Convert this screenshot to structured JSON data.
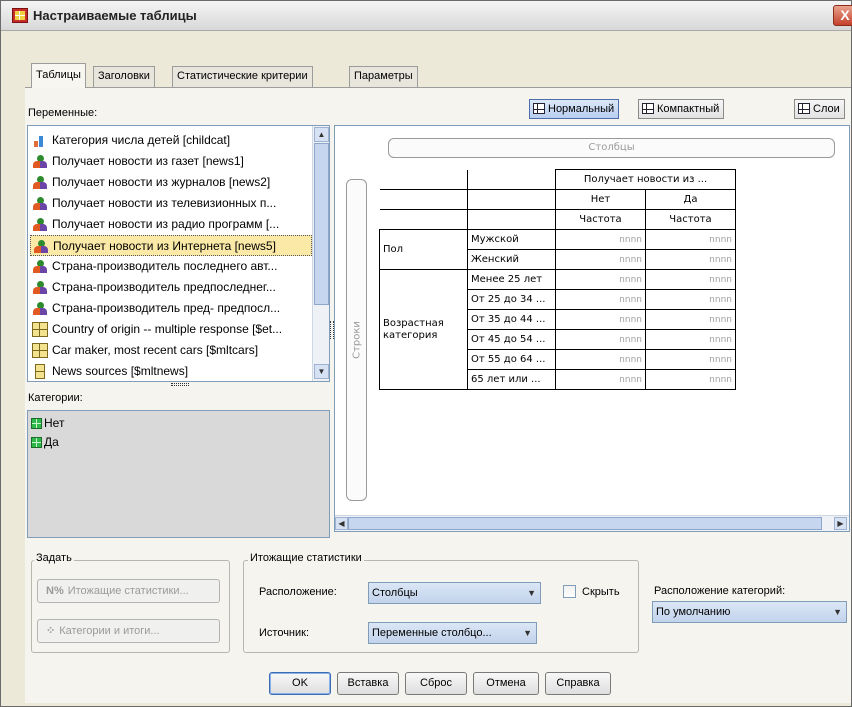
{
  "window": {
    "title": "Настраиваемые таблицы",
    "close_glyph": "X"
  },
  "tabs": [
    "Таблицы",
    "Заголовки",
    "Статистические критерии",
    "Параметры"
  ],
  "variables_label": "Переменные:",
  "view_buttons": {
    "normal": "Нормальный",
    "compact": "Компактный",
    "layers": "Слои"
  },
  "variables": [
    {
      "icon": "ordinal-bar-icon",
      "label": "Категория числа детей [childcat]"
    },
    {
      "icon": "nominal-person-icon",
      "label": "Получает новости из газет [news1]"
    },
    {
      "icon": "nominal-person-icon",
      "label": "Получает новости из журналов [news2]"
    },
    {
      "icon": "nominal-person-icon",
      "label": "Получает новости из телевизионных п..."
    },
    {
      "icon": "nominal-person-icon",
      "label": "Получает новости из радио программ [..."
    },
    {
      "icon": "nominal-person-icon",
      "label": "Получает новости из Интернета [news5]"
    },
    {
      "icon": "nominal-person-icon",
      "label": "Страна-производитель последнего авт..."
    },
    {
      "icon": "nominal-person-icon",
      "label": "Страна-производитель предпоследнег..."
    },
    {
      "icon": "nominal-person-icon",
      "label": "Страна-производитель пред- предпосл..."
    },
    {
      "icon": "multiple-response-icon",
      "label": "Country of origin -- multiple response [$et..."
    },
    {
      "icon": "multiple-response-icon",
      "label": "Car maker, most recent cars [$mltcars]"
    },
    {
      "icon": "multiple-response-single-icon",
      "label": "News sources [$mltnews]"
    }
  ],
  "selected_variable_index": 5,
  "categories_label": "Категории:",
  "categories": [
    "Нет",
    "Да"
  ],
  "canvas": {
    "columns_zone": "Столбцы",
    "rows_zone": "Строки",
    "table": {
      "col_var": "Получает новости из ...",
      "col_cats": [
        "Нет",
        "Да"
      ],
      "stat": "Частота",
      "row_groups": [
        {
          "var": "Пол",
          "cats": [
            "Мужской",
            "Женский"
          ]
        },
        {
          "var": "Возрастная категория",
          "cats": [
            "Менее 25 лет",
            "От 25 до 34 ...",
            "От 35 до 44 ...",
            "От 45 до 54 ...",
            "От 55 до 64 ...",
            "65 лет или ..."
          ]
        }
      ],
      "cell_placeholder": "nnnn"
    }
  },
  "define_group": {
    "title": "Задать",
    "summary_stats_btn": "Итожащие статистики...",
    "categories_btn": "Категории и итоги..."
  },
  "summary_group": {
    "title": "Итожащие статистики",
    "position_label": "Расположение:",
    "position_value": "Столбцы",
    "hide_label": "Скрыть",
    "source_label": "Источник:",
    "source_value": "Переменные столбцо..."
  },
  "category_position": {
    "label": "Расположение категорий:",
    "value": "По умолчанию"
  },
  "dialog_buttons": [
    "OK",
    "Вставка",
    "Сброс",
    "Отмена",
    "Справка"
  ]
}
